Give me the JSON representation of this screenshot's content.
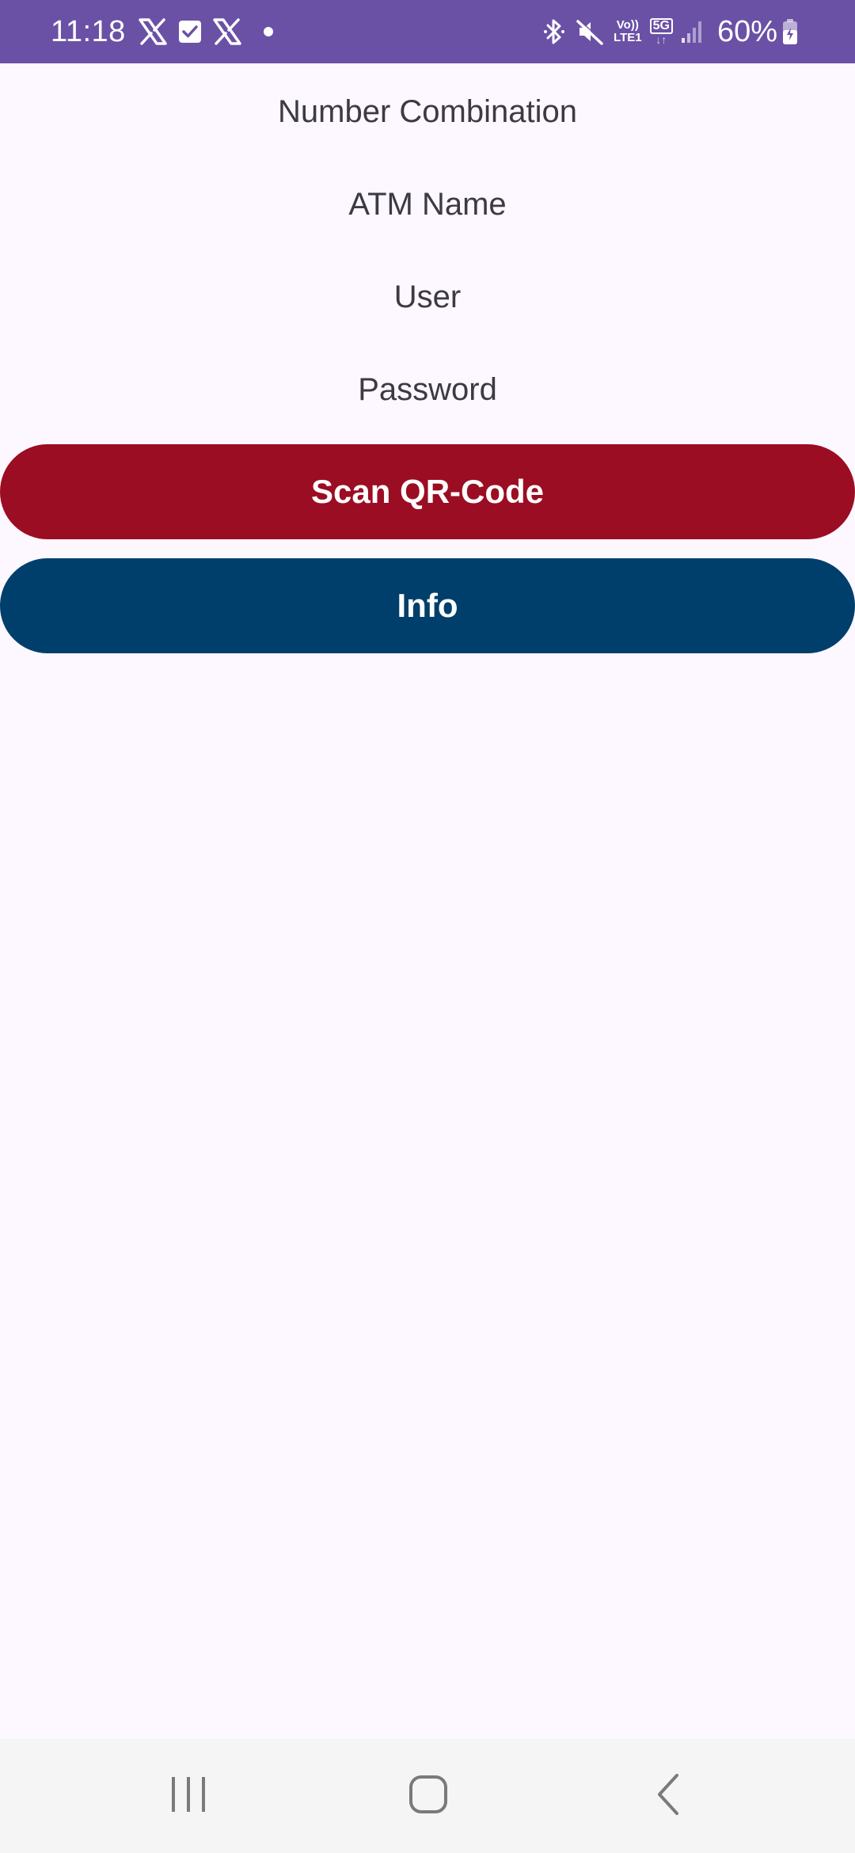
{
  "status_bar": {
    "time": "11:18",
    "left_icons": [
      "x-icon",
      "checkbox-icon",
      "x-icon",
      "dot-icon"
    ],
    "right_icons": [
      "bluetooth-icon",
      "mute-icon",
      "volte-icon",
      "5g-icon",
      "signal-icon",
      "battery-icon"
    ],
    "volte_top": "Vo))",
    "volte_bottom": "LTE1",
    "network": "5G",
    "battery": "60%"
  },
  "form": {
    "number_combination_label": "Number Combination",
    "atm_name_label": "ATM Name",
    "user_label": "User",
    "password_label": "Password"
  },
  "buttons": {
    "scan_label": "Scan QR-Code",
    "info_label": "Info"
  },
  "colors": {
    "status_bar": "#6a51a6",
    "background": "#fdf7ff",
    "scan_button": "#9b0d22",
    "info_button": "#003f6b",
    "label_text": "#3c3a42",
    "nav_bar": "#f5f5f5",
    "nav_icon": "#7a7a7a"
  },
  "navigation": {
    "icons": [
      "recents-icon",
      "home-icon",
      "back-icon"
    ]
  }
}
